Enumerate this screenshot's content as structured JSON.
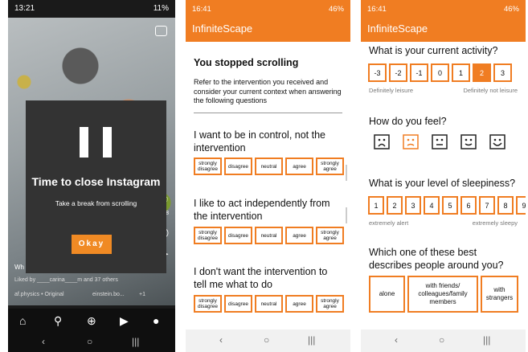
{
  "phone1": {
    "status_time": "13:21",
    "status_right": "11%",
    "modal_title": "Time to close Instagram",
    "modal_subtitle": "Take a break from scrolling",
    "okay_label": "Okay",
    "liked_by": "Liked by ____carina____m and 37 others",
    "audio": "af.physics • Original",
    "user": "einstein.bo...",
    "plus_count": "+1",
    "side_count": "38",
    "caption_prefix": "Wh"
  },
  "phone2": {
    "status_time": "16:41",
    "status_right": "46%",
    "app_title": "InfiniteScape",
    "heading": "You stopped scrolling",
    "instructions": "Refer to the intervention you received and consider your current context when answering the following questions",
    "likert_options": [
      "strongly disagree",
      "disagree",
      "neutral",
      "agree",
      "strongly agree"
    ],
    "statements": [
      "I want to be in control, not the intervention",
      "I like to act independently from the intervention",
      "I don't want the intervention to tell me what to do"
    ]
  },
  "phone3": {
    "status_time": "16:41",
    "status_right": "46%",
    "app_title": "InfiniteScape",
    "activity_q": "What is your current activity?",
    "activity_scale": [
      "-3",
      "-2",
      "-1",
      "0",
      "1",
      "2",
      "3"
    ],
    "activity_selected": "2",
    "activity_left": "Definitely leisure",
    "activity_right": "Definitely not leisure",
    "feel_q": "How do you feel?",
    "faces": [
      "very-sad-face-icon",
      "sad-face-icon",
      "neutral-face-icon",
      "happy-face-icon",
      "very-happy-face-icon"
    ],
    "sleep_q": "What is your level of sleepiness?",
    "sleep_scale": [
      "1",
      "2",
      "3",
      "4",
      "5",
      "6",
      "7",
      "8",
      "9"
    ],
    "sleep_left": "extremely alert",
    "sleep_right": "extremely sleepy",
    "people_q": "Which one of these best describes people around you?",
    "people_options": [
      "alone",
      "with friends/ colleagues/family members",
      "with strangers"
    ]
  },
  "colors": {
    "accent": "#f07d22",
    "modal": "#333333"
  }
}
